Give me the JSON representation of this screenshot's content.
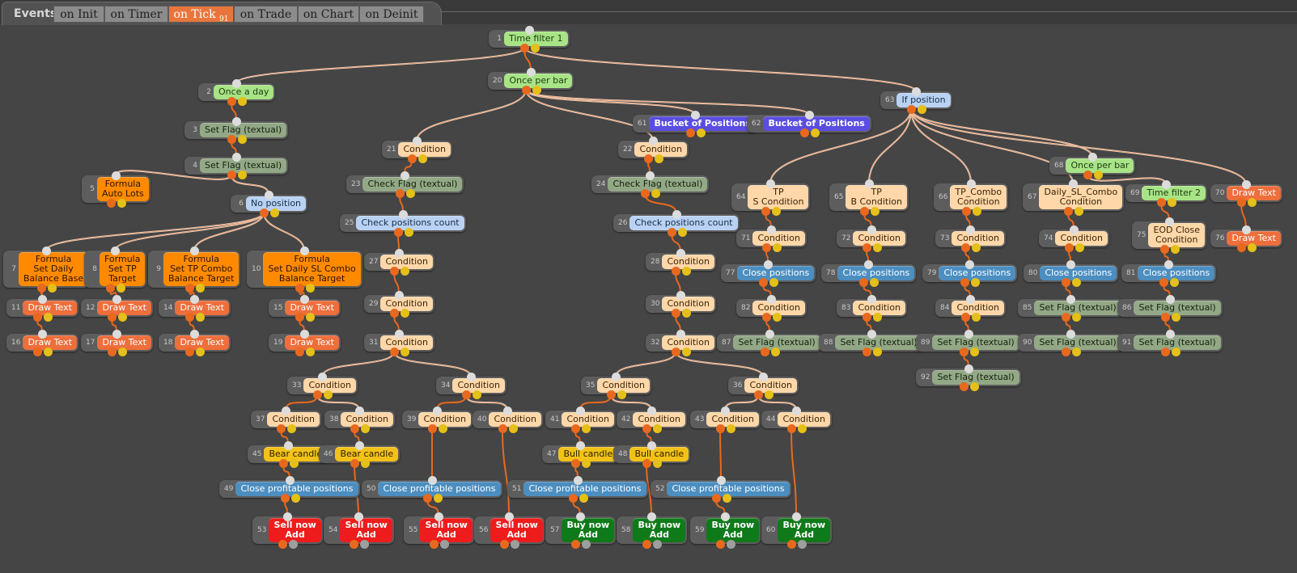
{
  "tabbar": {
    "events_label": "Events",
    "tabs": [
      {
        "label": "on Init",
        "active": false
      },
      {
        "label": "on Timer",
        "active": false
      },
      {
        "label": "on Tick",
        "badge": "91",
        "active": true
      },
      {
        "label": "on Trade",
        "active": false
      },
      {
        "label": "on Chart",
        "active": false
      },
      {
        "label": "on Deinit",
        "active": false
      }
    ]
  },
  "colors": {
    "background": "#454545",
    "edge_main": "#e8691e",
    "edge_light": "#f3e1d6",
    "pin_in": "#dcdcdc",
    "pin_out": "#e8691e",
    "pin_alt": "#e4c018",
    "active_tab": "#e8763c"
  },
  "node_types": {
    "green": "Time filter / Once block",
    "sage": "Set/Check Flag",
    "orange": "Formula",
    "lblue": "Position check",
    "dblue": "Bucket of Positions",
    "peach": "Condition",
    "salmon": "Draw Text",
    "steel": "Close positions",
    "yellow": "Candle",
    "red": "Sell now",
    "dgreen": "Buy now"
  },
  "nodes": [
    {
      "id": "1",
      "type": "green",
      "lines": [
        "Time filter 1"
      ]
    },
    {
      "id": "2",
      "type": "green",
      "lines": [
        "Once a day"
      ]
    },
    {
      "id": "3",
      "type": "sage",
      "lines": [
        "Set Flag (textual)"
      ]
    },
    {
      "id": "4",
      "type": "sage",
      "lines": [
        "Set Flag (textual)"
      ]
    },
    {
      "id": "5",
      "type": "orange",
      "lines": [
        "Formula",
        "Auto Lots"
      ]
    },
    {
      "id": "6",
      "type": "lblue",
      "lines": [
        "No position"
      ]
    },
    {
      "id": "7",
      "type": "orange",
      "lines": [
        "Formula",
        "Set Daily",
        "Balance Base"
      ]
    },
    {
      "id": "8",
      "type": "orange",
      "lines": [
        "Formula",
        "Set TP",
        "Target"
      ]
    },
    {
      "id": "9",
      "type": "orange",
      "lines": [
        "Formula",
        "Set TP Combo",
        "Balance Target"
      ]
    },
    {
      "id": "10",
      "type": "orange",
      "lines": [
        "Formula",
        "Set Daily SL Combo",
        "Balance Target"
      ]
    },
    {
      "id": "11",
      "type": "salmon",
      "lines": [
        "Draw Text"
      ]
    },
    {
      "id": "12",
      "type": "salmon",
      "lines": [
        "Draw Text"
      ]
    },
    {
      "id": "14",
      "type": "salmon",
      "lines": [
        "Draw Text"
      ]
    },
    {
      "id": "15",
      "type": "salmon",
      "lines": [
        "Draw Text"
      ]
    },
    {
      "id": "16",
      "type": "salmon",
      "lines": [
        "Draw Text"
      ]
    },
    {
      "id": "17",
      "type": "salmon",
      "lines": [
        "Draw Text"
      ]
    },
    {
      "id": "18",
      "type": "salmon",
      "lines": [
        "Draw Text"
      ]
    },
    {
      "id": "19",
      "type": "salmon",
      "lines": [
        "Draw Text"
      ]
    },
    {
      "id": "20",
      "type": "green",
      "lines": [
        "Once per bar"
      ]
    },
    {
      "id": "21",
      "type": "peach",
      "lines": [
        "Condition"
      ]
    },
    {
      "id": "22",
      "type": "peach",
      "lines": [
        "Condition"
      ]
    },
    {
      "id": "23",
      "type": "sage",
      "lines": [
        "Check Flag (textual)"
      ]
    },
    {
      "id": "24",
      "type": "sage",
      "lines": [
        "Check Flag (textual)"
      ]
    },
    {
      "id": "25",
      "type": "lblue",
      "lines": [
        "Check positions count"
      ]
    },
    {
      "id": "26",
      "type": "lblue",
      "lines": [
        "Check positions count"
      ]
    },
    {
      "id": "27",
      "type": "peach",
      "lines": [
        "Condition"
      ]
    },
    {
      "id": "28",
      "type": "peach",
      "lines": [
        "Condition"
      ]
    },
    {
      "id": "29",
      "type": "peach",
      "lines": [
        "Condition"
      ]
    },
    {
      "id": "30",
      "type": "peach",
      "lines": [
        "Condition"
      ]
    },
    {
      "id": "31",
      "type": "peach",
      "lines": [
        "Condition"
      ]
    },
    {
      "id": "32",
      "type": "peach",
      "lines": [
        "Condition"
      ]
    },
    {
      "id": "33",
      "type": "peach",
      "lines": [
        "Condition"
      ]
    },
    {
      "id": "34",
      "type": "peach",
      "lines": [
        "Condition"
      ]
    },
    {
      "id": "35",
      "type": "peach",
      "lines": [
        "Condition"
      ]
    },
    {
      "id": "36",
      "type": "peach",
      "lines": [
        "Condition"
      ]
    },
    {
      "id": "37",
      "type": "peach",
      "lines": [
        "Condition"
      ]
    },
    {
      "id": "38",
      "type": "peach",
      "lines": [
        "Condition"
      ]
    },
    {
      "id": "39",
      "type": "peach",
      "lines": [
        "Condition"
      ]
    },
    {
      "id": "40",
      "type": "peach",
      "lines": [
        "Condition"
      ]
    },
    {
      "id": "41",
      "type": "peach",
      "lines": [
        "Condition"
      ]
    },
    {
      "id": "42",
      "type": "peach",
      "lines": [
        "Condition"
      ]
    },
    {
      "id": "43",
      "type": "peach",
      "lines": [
        "Condition"
      ]
    },
    {
      "id": "44",
      "type": "peach",
      "lines": [
        "Condition"
      ]
    },
    {
      "id": "45",
      "type": "yellow",
      "lines": [
        "Bear candle"
      ]
    },
    {
      "id": "46",
      "type": "yellow",
      "lines": [
        "Bear candle"
      ]
    },
    {
      "id": "47",
      "type": "yellow",
      "lines": [
        "Bull candle"
      ]
    },
    {
      "id": "48",
      "type": "yellow",
      "lines": [
        "Bull candle"
      ]
    },
    {
      "id": "49",
      "type": "steel",
      "lines": [
        "Close profitable positions"
      ]
    },
    {
      "id": "50",
      "type": "steel",
      "lines": [
        "Close profitable positions"
      ]
    },
    {
      "id": "51",
      "type": "steel",
      "lines": [
        "Close profitable positions"
      ]
    },
    {
      "id": "52",
      "type": "steel",
      "lines": [
        "Close profitable positions"
      ]
    },
    {
      "id": "53",
      "type": "red",
      "lines": [
        "Sell now",
        "Add"
      ]
    },
    {
      "id": "54",
      "type": "red",
      "lines": [
        "Sell now",
        "Add"
      ]
    },
    {
      "id": "55",
      "type": "red",
      "lines": [
        "Sell now",
        "Add"
      ]
    },
    {
      "id": "56",
      "type": "red",
      "lines": [
        "Sell now",
        "Add"
      ]
    },
    {
      "id": "57",
      "type": "dgreen",
      "lines": [
        "Buy now",
        "Add"
      ]
    },
    {
      "id": "58",
      "type": "dgreen",
      "lines": [
        "Buy now",
        "Add"
      ]
    },
    {
      "id": "59",
      "type": "dgreen",
      "lines": [
        "Buy now",
        "Add"
      ]
    },
    {
      "id": "60",
      "type": "dgreen",
      "lines": [
        "Buy now",
        "Add"
      ]
    },
    {
      "id": "61",
      "type": "dblue",
      "lines": [
        "Bucket of Positions"
      ]
    },
    {
      "id": "62",
      "type": "dblue",
      "lines": [
        "Bucket of Positions"
      ]
    },
    {
      "id": "63",
      "type": "lblue",
      "lines": [
        "If position"
      ]
    },
    {
      "id": "64",
      "type": "peach",
      "lines": [
        "TP",
        "S Condition"
      ]
    },
    {
      "id": "65",
      "type": "peach",
      "lines": [
        "TP",
        "B Condition"
      ]
    },
    {
      "id": "66",
      "type": "peach",
      "lines": [
        "TP_Combo",
        "Condition"
      ]
    },
    {
      "id": "67",
      "type": "peach",
      "lines": [
        "Daily_SL_Combo",
        "Condition"
      ]
    },
    {
      "id": "68",
      "type": "green",
      "lines": [
        "Once per bar"
      ]
    },
    {
      "id": "69",
      "type": "green",
      "lines": [
        "Time filter 2"
      ]
    },
    {
      "id": "70",
      "type": "salmon",
      "lines": [
        "Draw Text"
      ]
    },
    {
      "id": "71",
      "type": "peach",
      "lines": [
        "Condition"
      ]
    },
    {
      "id": "72",
      "type": "peach",
      "lines": [
        "Condition"
      ]
    },
    {
      "id": "73",
      "type": "peach",
      "lines": [
        "Condition"
      ]
    },
    {
      "id": "74",
      "type": "peach",
      "lines": [
        "Condition"
      ]
    },
    {
      "id": "75",
      "type": "peach",
      "lines": [
        "EOD Close",
        "Condition"
      ]
    },
    {
      "id": "76",
      "type": "salmon",
      "lines": [
        "Draw Text"
      ]
    },
    {
      "id": "77",
      "type": "steel",
      "lines": [
        "Close positions"
      ]
    },
    {
      "id": "78",
      "type": "steel",
      "lines": [
        "Close positions"
      ]
    },
    {
      "id": "79",
      "type": "steel",
      "lines": [
        "Close positions"
      ]
    },
    {
      "id": "80",
      "type": "steel",
      "lines": [
        "Close positions"
      ]
    },
    {
      "id": "81",
      "type": "steel",
      "lines": [
        "Close positions"
      ]
    },
    {
      "id": "82",
      "type": "peach",
      "lines": [
        "Condition"
      ]
    },
    {
      "id": "83",
      "type": "peach",
      "lines": [
        "Condition"
      ]
    },
    {
      "id": "84",
      "type": "peach",
      "lines": [
        "Condition"
      ]
    },
    {
      "id": "85",
      "type": "sage",
      "lines": [
        "Set Flag (textual)"
      ]
    },
    {
      "id": "86",
      "type": "sage",
      "lines": [
        "Set Flag (textual)"
      ]
    },
    {
      "id": "87",
      "type": "sage",
      "lines": [
        "Set Flag (textual)"
      ]
    },
    {
      "id": "88",
      "type": "sage",
      "lines": [
        "Set Flag (textual)"
      ]
    },
    {
      "id": "89",
      "type": "sage",
      "lines": [
        "Set Flag (textual)"
      ]
    },
    {
      "id": "90",
      "type": "sage",
      "lines": [
        "Set Flag (textual)"
      ]
    },
    {
      "id": "91",
      "type": "sage",
      "lines": [
        "Set Flag (textual)"
      ]
    },
    {
      "id": "92",
      "type": "sage",
      "lines": [
        "Set Flag (textual)"
      ]
    }
  ],
  "edges": [
    [
      "1",
      "2"
    ],
    [
      "1",
      "20"
    ],
    [
      "1",
      "63"
    ],
    [
      "2",
      "3"
    ],
    [
      "3",
      "4"
    ],
    [
      "4",
      "5"
    ],
    [
      "4",
      "6"
    ],
    [
      "6",
      "7"
    ],
    [
      "6",
      "8"
    ],
    [
      "6",
      "9"
    ],
    [
      "6",
      "10"
    ],
    [
      "7",
      "11"
    ],
    [
      "8",
      "12"
    ],
    [
      "9",
      "14"
    ],
    [
      "10",
      "15"
    ],
    [
      "11",
      "16"
    ],
    [
      "12",
      "17"
    ],
    [
      "14",
      "18"
    ],
    [
      "15",
      "19"
    ],
    [
      "20",
      "21"
    ],
    [
      "20",
      "22"
    ],
    [
      "20",
      "61"
    ],
    [
      "20",
      "62"
    ],
    [
      "21",
      "23"
    ],
    [
      "23",
      "25"
    ],
    [
      "25",
      "27"
    ],
    [
      "27",
      "29"
    ],
    [
      "29",
      "31"
    ],
    [
      "31",
      "33"
    ],
    [
      "31",
      "34"
    ],
    [
      "33",
      "37"
    ],
    [
      "33",
      "38"
    ],
    [
      "34",
      "39"
    ],
    [
      "34",
      "40"
    ],
    [
      "37",
      "45"
    ],
    [
      "38",
      "46"
    ],
    [
      "45",
      "49"
    ],
    [
      "39",
      "50"
    ],
    [
      "49",
      "53"
    ],
    [
      "46",
      "54"
    ],
    [
      "50",
      "55"
    ],
    [
      "40",
      "56"
    ],
    [
      "22",
      "24"
    ],
    [
      "24",
      "26"
    ],
    [
      "26",
      "28"
    ],
    [
      "28",
      "30"
    ],
    [
      "30",
      "32"
    ],
    [
      "32",
      "35"
    ],
    [
      "32",
      "36"
    ],
    [
      "35",
      "41"
    ],
    [
      "35",
      "42"
    ],
    [
      "36",
      "43"
    ],
    [
      "36",
      "44"
    ],
    [
      "41",
      "47"
    ],
    [
      "42",
      "48"
    ],
    [
      "47",
      "51"
    ],
    [
      "43",
      "52"
    ],
    [
      "51",
      "57"
    ],
    [
      "48",
      "58"
    ],
    [
      "52",
      "59"
    ],
    [
      "44",
      "60"
    ],
    [
      "63",
      "64"
    ],
    [
      "63",
      "65"
    ],
    [
      "63",
      "66"
    ],
    [
      "63",
      "67"
    ],
    [
      "63",
      "68"
    ],
    [
      "63",
      "70"
    ],
    [
      "68",
      "69"
    ],
    [
      "69",
      "75"
    ],
    [
      "70",
      "76"
    ],
    [
      "64",
      "71"
    ],
    [
      "65",
      "72"
    ],
    [
      "66",
      "73"
    ],
    [
      "67",
      "74"
    ],
    [
      "71",
      "77"
    ],
    [
      "72",
      "78"
    ],
    [
      "73",
      "79"
    ],
    [
      "74",
      "80"
    ],
    [
      "75",
      "81"
    ],
    [
      "77",
      "82"
    ],
    [
      "78",
      "83"
    ],
    [
      "79",
      "84"
    ],
    [
      "80",
      "85"
    ],
    [
      "81",
      "86"
    ],
    [
      "82",
      "87"
    ],
    [
      "83",
      "88"
    ],
    [
      "84",
      "89"
    ],
    [
      "85",
      "90"
    ],
    [
      "86",
      "91"
    ],
    [
      "89",
      "92"
    ]
  ]
}
